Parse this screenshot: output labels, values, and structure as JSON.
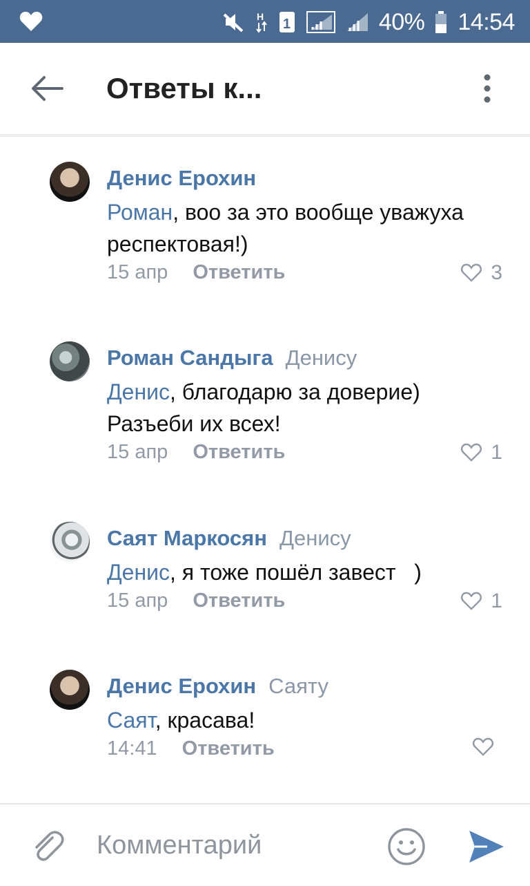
{
  "status_bar": {
    "battery": "40%",
    "time": "14:54",
    "icons": [
      "heart-icon",
      "mute-icon",
      "data-h-icon",
      "sim-1-icon",
      "signal-icon",
      "signal-icon",
      "battery-icon"
    ]
  },
  "toolbar": {
    "title": "Ответы к..."
  },
  "comments": [
    {
      "author": "Денис Ерохин",
      "reply_to": "",
      "mention": "Роман",
      "text": ", воо за это вообще уважуха респектовая!)",
      "date": "15 апр",
      "reply_label": "Ответить",
      "likes": "3"
    },
    {
      "author": "Роман Сандыга",
      "reply_to": "Денису",
      "mention": "Денис",
      "text": ", благодарю за доверие) Разъеби их всех!",
      "date": "15 апр",
      "reply_label": "Ответить",
      "likes": "1"
    },
    {
      "author": "Саят Маркосян",
      "reply_to": "Денису",
      "mention": "Денис",
      "text": ", я тоже пошёл завест   )",
      "date": "15 апр",
      "reply_label": "Ответить",
      "likes": "1"
    },
    {
      "author": "Денис Ерохин",
      "reply_to": "Саяту",
      "mention": "Саят",
      "text": ", красава!",
      "date": "14:41",
      "reply_label": "Ответить",
      "likes": ""
    }
  ],
  "input": {
    "placeholder": "Комментарий"
  },
  "colors": {
    "status_bar": "#4a6a91",
    "accent": "#4a76a8",
    "secondary_text": "#929aa6",
    "send_icon": "#5181b8"
  }
}
